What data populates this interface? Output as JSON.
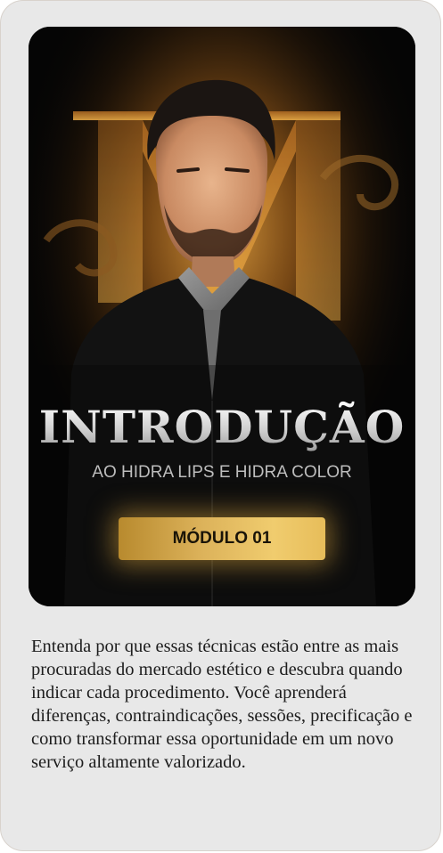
{
  "cover": {
    "title": "INTRODUÇÃO",
    "subtitle": "AO HIDRA LIPS E HIDRA COLOR",
    "module_button": "MÓDULO 01",
    "colors": {
      "gold": "#e0b45c",
      "background": "#050505"
    }
  },
  "description": "Entenda por que essas técnicas estão entre as mais procuradas do mercado estético e descubra quando indicar cada procedimento. Você aprenderá diferenças, contraindicações, sessões, precificação e como transformar essa oportunidade em um novo serviço altamente valorizado."
}
